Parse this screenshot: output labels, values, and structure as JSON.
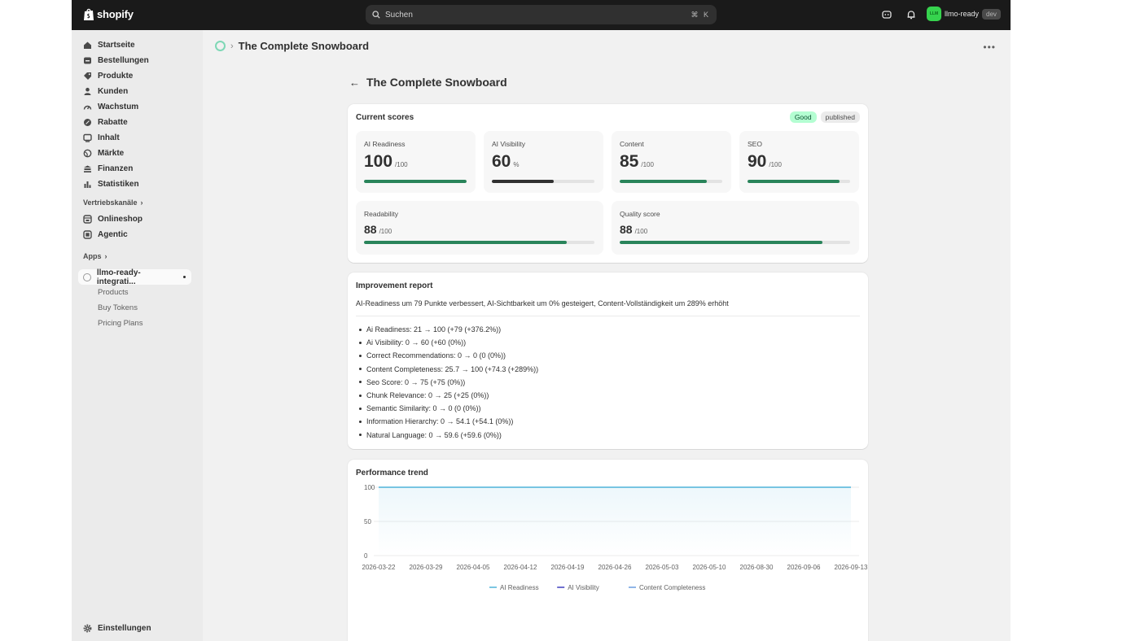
{
  "topbar": {
    "logo_text": "shopify",
    "search_placeholder": "Suchen",
    "search_shortcut": "⌘ K",
    "avatar_initials": "LLM",
    "account_name": "llmo-ready",
    "account_tag": "dev"
  },
  "sidebar": {
    "items": [
      {
        "label": "Startseite",
        "icon": "home-icon"
      },
      {
        "label": "Bestellungen",
        "icon": "orders-icon"
      },
      {
        "label": "Produkte",
        "icon": "tag-icon"
      },
      {
        "label": "Kunden",
        "icon": "person-icon"
      },
      {
        "label": "Wachstum",
        "icon": "gauge-icon"
      },
      {
        "label": "Rabatte",
        "icon": "discount-icon"
      },
      {
        "label": "Inhalt",
        "icon": "content-icon"
      },
      {
        "label": "Märkte",
        "icon": "globe-icon"
      },
      {
        "label": "Finanzen",
        "icon": "bank-icon"
      },
      {
        "label": "Statistiken",
        "icon": "chart-icon"
      }
    ],
    "channels_heading": "Vertriebskanäle",
    "channels": [
      {
        "label": "Onlineshop",
        "icon": "store-icon"
      },
      {
        "label": "Agentic",
        "icon": "agentic-icon"
      }
    ],
    "apps_heading": "Apps",
    "app_name": "llmo-ready-integrati...",
    "app_subitems": [
      "Products",
      "Buy Tokens",
      "Pricing Plans"
    ],
    "settings_label": "Einstellungen"
  },
  "main": {
    "breadcrumb_title": "The Complete Snowboard",
    "page_title": "The Complete Snowboard",
    "scores": {
      "title": "Current scores",
      "badge_status": "Good",
      "badge_state": "published",
      "metrics": [
        {
          "label": "AI Readiness",
          "value": "100",
          "unit": "/100",
          "progress": 1.0
        },
        {
          "label": "AI Visibility",
          "value": "60",
          "unit": "%",
          "progress": 0.6
        },
        {
          "label": "Content",
          "value": "85",
          "unit": "/100",
          "progress": 0.85
        },
        {
          "label": "SEO",
          "value": "90",
          "unit": "/100",
          "progress": 0.9
        },
        {
          "label": "Readability",
          "value": "88",
          "unit": "/100",
          "progress": 0.88
        },
        {
          "label": "Quality score",
          "value": "88",
          "unit": "/100",
          "progress": 0.88
        }
      ]
    },
    "report": {
      "title": "Improvement report",
      "summary": "AI-Readiness um 79 Punkte verbessert, AI-Sichtbarkeit um 0% gesteigert, Content-Vollständigkeit um 289% erhöht",
      "items": [
        "Ai Readiness: 21 → 100 (+79 (+376.2%))",
        "Ai Visibility: 0 → 60 (+60 (0%))",
        "Correct Recommendations: 0 → 0 (0 (0%))",
        "Content Completeness: 25.7 → 100 (+74.3 (+289%))",
        "Seo Score: 0 → 75 (+75 (0%))",
        "Chunk Relevance: 0 → 25 (+25 (0%))",
        "Semantic Similarity: 0 → 0 (0 (0%))",
        "Information Hierarchy: 0 → 54.1 (+54.1 (0%))",
        "Natural Language: 0 → 59.6 (+59.6 (0%))"
      ]
    },
    "trend": {
      "title": "Performance trend"
    }
  },
  "colors": {
    "topbar_bg": "#1a1a1a",
    "success_bar": "#29845a",
    "visibility_bar": "#303030",
    "good_badge_bg": "#b4fed2",
    "readiness_line": "#4fb3d9",
    "visibility_line": "#3f3fbf",
    "completeness_line": "#6a9ee0"
  },
  "chart_data": {
    "type": "line",
    "x": [
      "2026-03-22",
      "2026-03-29",
      "2026-04-05",
      "2026-04-12",
      "2026-04-19",
      "2026-04-26",
      "2026-05-03",
      "2026-05-10",
      "2026-08-30",
      "2026-09-06",
      "2026-09-13"
    ],
    "ylim": [
      0,
      100
    ],
    "yticks": [
      "100",
      "50",
      "0"
    ],
    "series": [
      {
        "name": "AI Readiness",
        "values": [
          100,
          100,
          100,
          100,
          100,
          100,
          100,
          100,
          100,
          100,
          100
        ]
      },
      {
        "name": "AI Visibility",
        "values": []
      },
      {
        "name": "Content Completeness",
        "values": []
      }
    ],
    "grid": true,
    "legend": "bottom"
  }
}
